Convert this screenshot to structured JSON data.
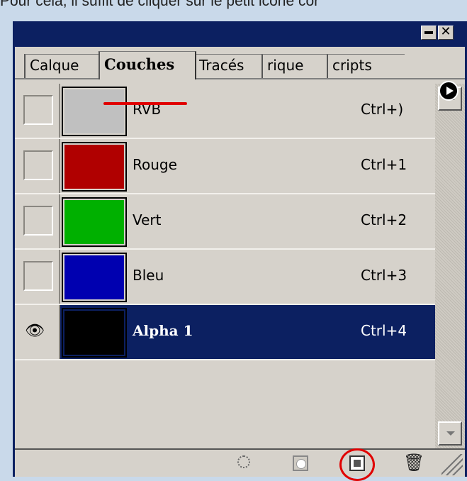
{
  "caption": "Pour cela, il suffit de cliquer sur le petit icône cor",
  "tabs": [
    "Calque",
    "Couches",
    "Tracés",
    "rique",
    "cripts"
  ],
  "channels": [
    {
      "name": "RVB",
      "shortcut": "Ctrl+)",
      "color": "#c0c0c0",
      "visible": false,
      "selected": false
    },
    {
      "name": "Rouge",
      "shortcut": "Ctrl+1",
      "color": "#b00000",
      "visible": false,
      "selected": false
    },
    {
      "name": "Vert",
      "shortcut": "Ctrl+2",
      "color": "#00b000",
      "visible": false,
      "selected": false
    },
    {
      "name": "Bleu",
      "shortcut": "Ctrl+3",
      "color": "#0000b0",
      "visible": false,
      "selected": false
    },
    {
      "name": "Alpha 1",
      "shortcut": "Ctrl+4",
      "color": "#000000",
      "visible": true,
      "selected": true
    }
  ],
  "colors": {
    "titlebar": "#0c2061",
    "panel": "#d6d2cb",
    "highlight": "#e00000"
  },
  "icons": {
    "eye": "👁",
    "trash": "🗑",
    "close": "✕"
  }
}
